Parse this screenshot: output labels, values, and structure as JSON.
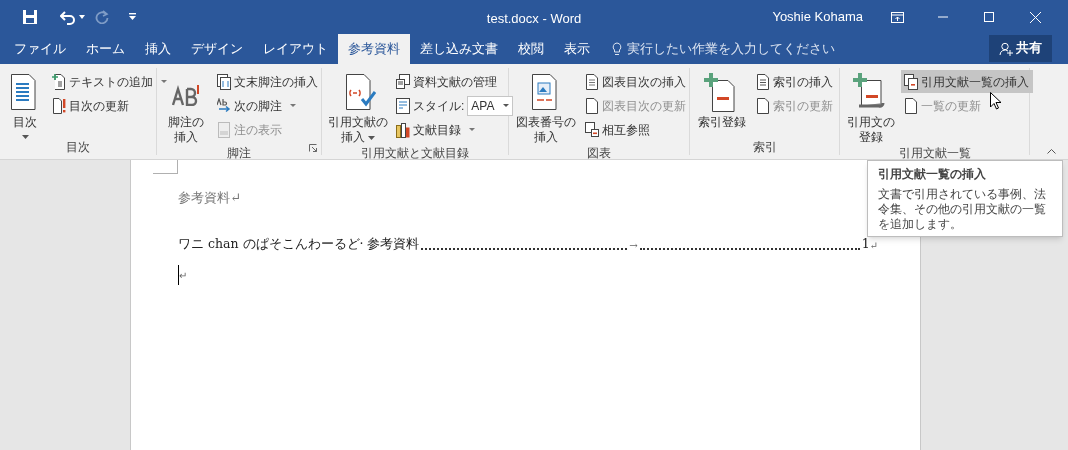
{
  "title_bar": {
    "title": "test.docx - Word",
    "user": "Yoshie Kohama"
  },
  "tabs": [
    {
      "label": "ファイル",
      "selected": false
    },
    {
      "label": "ホーム",
      "selected": false
    },
    {
      "label": "挿入",
      "selected": false
    },
    {
      "label": "デザイン",
      "selected": false
    },
    {
      "label": "レイアウト",
      "selected": false
    },
    {
      "label": "参考資料",
      "selected": true
    },
    {
      "label": "差し込み文書",
      "selected": false
    },
    {
      "label": "校閲",
      "selected": false
    },
    {
      "label": "表示",
      "selected": false
    }
  ],
  "tell_me": {
    "placeholder": "実行したい作業を入力してください"
  },
  "share": "共有",
  "ribbon": {
    "groups": [
      {
        "label": "目次",
        "launcher": false,
        "large": {
          "lines": [
            "目次"
          ],
          "dropdown": true
        },
        "small": [
          {
            "kind": "button",
            "label": "テキストの追加",
            "dropdown": true,
            "disabled": false,
            "hovered": false
          },
          {
            "kind": "button",
            "label": "目次の更新",
            "dropdown": false,
            "disabled": false,
            "hovered": false
          }
        ]
      },
      {
        "label": "脚注",
        "launcher": true,
        "large": {
          "lines": [
            "脚注の",
            "挿入"
          ],
          "dropdown": false
        },
        "small": [
          {
            "kind": "button",
            "label": "文末脚注の挿入",
            "dropdown": false,
            "disabled": false,
            "hovered": false
          },
          {
            "kind": "button",
            "label": "次の脚注",
            "dropdown": true,
            "disabled": false,
            "hovered": false
          },
          {
            "kind": "button",
            "label": "注の表示",
            "dropdown": false,
            "disabled": true,
            "hovered": false
          }
        ]
      },
      {
        "label": "引用文献と文献目録",
        "launcher": false,
        "large": {
          "lines": [
            "引用文献の",
            "挿入"
          ],
          "dropdown": true
        },
        "small": [
          {
            "kind": "button",
            "label": "資料文献の管理",
            "dropdown": false,
            "disabled": false,
            "hovered": false
          },
          {
            "kind": "combo",
            "label": "スタイル:",
            "value": "APA",
            "dropdown": true,
            "disabled": false,
            "hovered": false
          },
          {
            "kind": "button",
            "label": "文献目録",
            "dropdown": true,
            "disabled": false,
            "hovered": false
          }
        ]
      },
      {
        "label": "図表",
        "launcher": false,
        "large": {
          "lines": [
            "図表番号の",
            "挿入"
          ],
          "dropdown": false
        },
        "small": [
          {
            "kind": "button",
            "label": "図表目次の挿入",
            "dropdown": false,
            "disabled": false,
            "hovered": false
          },
          {
            "kind": "button",
            "label": "図表目次の更新",
            "dropdown": false,
            "disabled": true,
            "hovered": false
          },
          {
            "kind": "button",
            "label": "相互参照",
            "dropdown": false,
            "disabled": false,
            "hovered": false
          }
        ]
      },
      {
        "label": "索引",
        "launcher": false,
        "large": {
          "lines": [
            "索引登録"
          ],
          "dropdown": false
        },
        "small": [
          {
            "kind": "button",
            "label": "索引の挿入",
            "dropdown": false,
            "disabled": false,
            "hovered": false
          },
          {
            "kind": "button",
            "label": "索引の更新",
            "dropdown": false,
            "disabled": true,
            "hovered": false
          }
        ]
      },
      {
        "label": "引用文献一覧",
        "launcher": false,
        "large": {
          "lines": [
            "引用文の",
            "登録"
          ],
          "dropdown": false
        },
        "small": [
          {
            "kind": "button",
            "label": "引用文献一覧の挿入",
            "dropdown": false,
            "disabled": false,
            "hovered": true
          },
          {
            "kind": "button",
            "label": "一覧の更新",
            "dropdown": false,
            "disabled": true,
            "hovered": false
          }
        ]
      }
    ]
  },
  "tooltip": {
    "title": "引用文献一覧の挿入",
    "body": "文書で引用されている事例、法令集、その他の引用文献の一覧を追加します。"
  },
  "document": {
    "heading": "参考資料↵",
    "toc_entry": {
      "text": "ワニ chan のぱそこんわーるど· 参考資料",
      "tab_mark": "→",
      "page": "1",
      "end_mark": "↵"
    },
    "empty_paragraph": "↵"
  }
}
